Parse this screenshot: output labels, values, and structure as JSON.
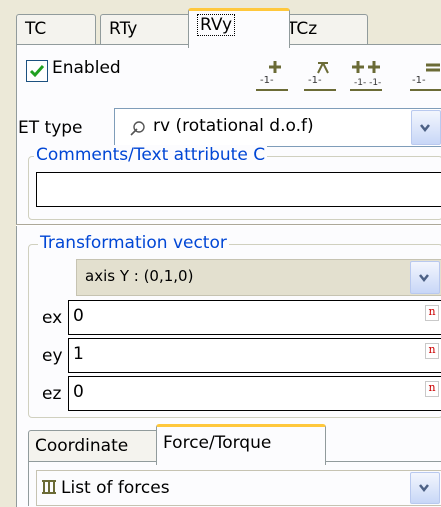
{
  "tabs": [
    {
      "label": "TC"
    },
    {
      "label": "RTy"
    },
    {
      "label": "RVy"
    },
    {
      "label": "TCz"
    }
  ],
  "enabled": {
    "label": "Enabled",
    "checked": true
  },
  "toolbar": {
    "icons": [
      "add-point-icon",
      "add-outline-icon",
      "add-pair-icon",
      "remove-icon"
    ]
  },
  "et_type": {
    "label": "ET type",
    "value": "rv (rotational d.o.f)"
  },
  "comments": {
    "title": "Comments/Text attribute C",
    "value": ""
  },
  "transformation": {
    "title": "Transformation vector",
    "axis_value": "axis Y : (0,1,0)",
    "fields": [
      {
        "label": "ex",
        "value": "0",
        "badge": "n"
      },
      {
        "label": "ey",
        "value": "1",
        "badge": "n"
      },
      {
        "label": "ez",
        "value": "0",
        "badge": "n"
      }
    ]
  },
  "bottom_tabs": [
    {
      "label": "Coordinate"
    },
    {
      "label": "Force/Torque"
    }
  ],
  "forces": {
    "value": "List of forces"
  },
  "colors": {
    "accent_tab": "#ffc83c",
    "group_title": "#0046d5",
    "check": "#21a121"
  }
}
